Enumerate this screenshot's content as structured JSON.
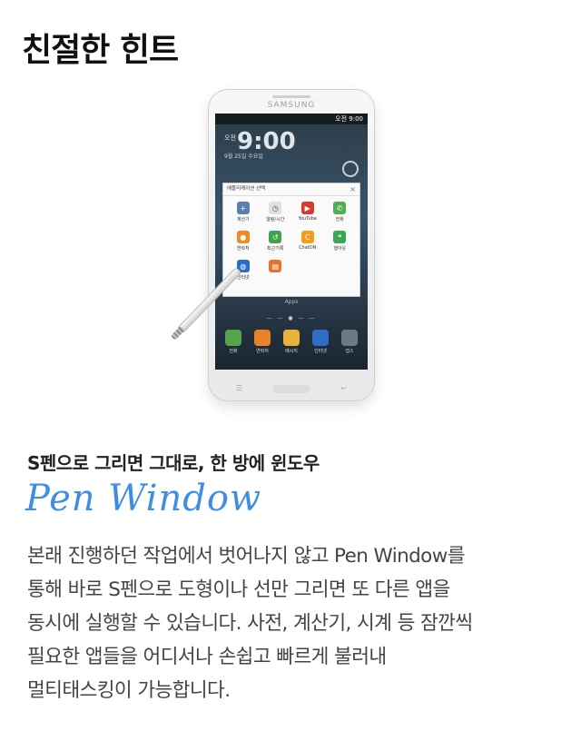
{
  "page_title": "친절한 힌트",
  "phone": {
    "brand": "SAMSUNG",
    "status": "오전 9:00",
    "clock": "9:00",
    "clock_label": "오전",
    "date": "9월 25일 수요일",
    "pen_window": {
      "title": "애플리케이션 선택",
      "close": "×",
      "apps": [
        {
          "label": "계산기",
          "icon": "calculator-icon",
          "color": "#5b7fb0",
          "glyph": "+"
        },
        {
          "label": "알림/시간",
          "icon": "clock-icon",
          "color": "#e0e0e0",
          "glyph": "◷"
        },
        {
          "label": "YouTube",
          "icon": "youtube-icon",
          "color": "#d43c33",
          "glyph": "▶"
        },
        {
          "label": "전화",
          "icon": "phone-icon",
          "color": "#4caf50",
          "glyph": "✆"
        },
        {
          "label": "연락처",
          "icon": "contacts-icon",
          "color": "#f08a24",
          "glyph": "●"
        },
        {
          "label": "최근기록",
          "icon": "recent-log-icon",
          "color": "#3fa34d",
          "glyph": "↺"
        },
        {
          "label": "ChatON",
          "icon": "chaton-icon",
          "color": "#f59b1e",
          "glyph": "C"
        },
        {
          "label": "행아웃",
          "icon": "hangouts-icon",
          "color": "#3aa757",
          "glyph": "❝"
        },
        {
          "label": "인터넷",
          "icon": "internet-icon",
          "color": "#2f6cc4",
          "glyph": "◍"
        },
        {
          "label": "",
          "icon": "notes-icon",
          "color": "#e3742b",
          "glyph": "▤"
        }
      ]
    },
    "apps_label": "Apps",
    "dock": [
      {
        "label": "전화",
        "icon": "phone-icon",
        "color": "#55a34a"
      },
      {
        "label": "연락처",
        "icon": "contacts-icon",
        "color": "#e8832a"
      },
      {
        "label": "메시지",
        "icon": "messages-icon",
        "color": "#e8b23b"
      },
      {
        "label": "인터넷",
        "icon": "internet-icon",
        "color": "#2f6cc4"
      },
      {
        "label": "앱스",
        "icon": "apps-grid-icon",
        "color": "#6d7a84"
      }
    ]
  },
  "subtitle": "S펜으로 그리면 그대로, 한 방에 윈도우",
  "script_title": "Pen Window",
  "body_lines": [
    "본래 진행하던 작업에서 벗어나지 않고 Pen Window를",
    "통해 바로 S펜으로 도형이나 선만 그리면  또 다른 앱을",
    "동시에 실행할 수 있습니다. 사전, 계산기, 시계 등 잠깐씩",
    "필요한 앱들을 어디서나 손쉽고 빠르게 불러내",
    "멀티태스킹이 가능합니다."
  ]
}
